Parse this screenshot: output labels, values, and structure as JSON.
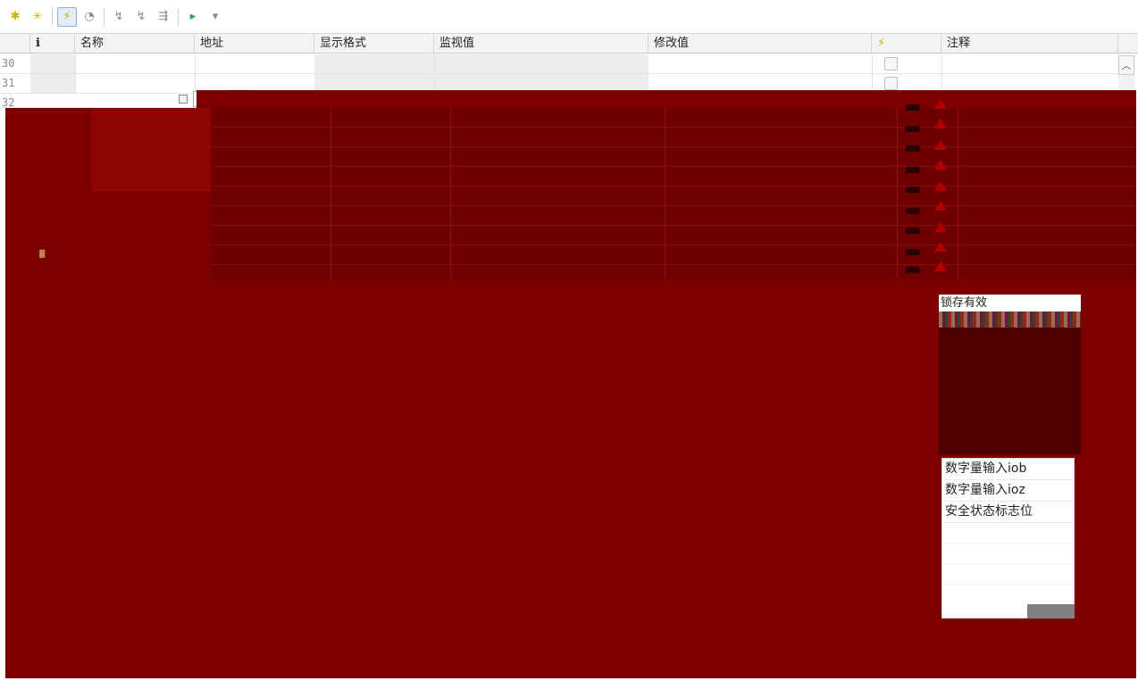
{
  "toolbar": {
    "buttons": [
      {
        "icon": "insert-row-icon"
      },
      {
        "icon": "add-row-icon"
      },
      {
        "icon": "show-force-columns-icon"
      },
      {
        "icon": "expanded-mode-icon"
      },
      {
        "icon": "modify-now-icon"
      },
      {
        "icon": "modify-with-trigger-icon"
      },
      {
        "icon": "enable-peripheral-outputs-icon"
      },
      {
        "icon": "monitor-all-icon"
      },
      {
        "icon": "monitor-now-icon"
      }
    ]
  },
  "table": {
    "columns": {
      "info": "i",
      "name": "名称",
      "address": "地址",
      "display_format": "显示格式",
      "monitor_value": "监视值",
      "modify_value": "修改值",
      "modify_flag": "⚡",
      "comment": "注释"
    },
    "rows": [
      {
        "num": "30"
      },
      {
        "num": "31"
      },
      {
        "num": "32"
      }
    ],
    "edit_cell_text": "%"
  },
  "popup_top": {
    "title": "锁存有效"
  },
  "popup_list": {
    "items": [
      "数字量输入iob",
      "数字量输入ioz",
      "安全状态标志位"
    ]
  },
  "colors": {
    "overlay_red": "#7d0000",
    "header_bg": "#f3f3f3",
    "popup_dark": "#4e0000"
  }
}
